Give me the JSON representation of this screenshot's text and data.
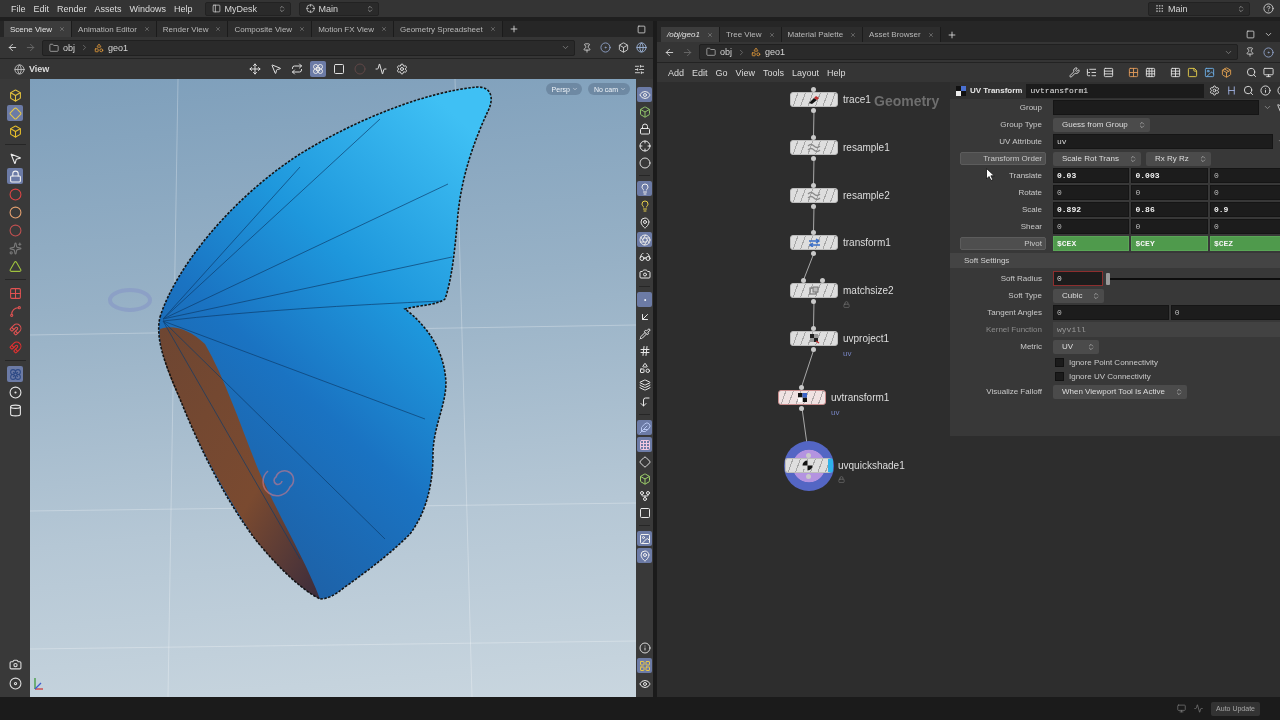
{
  "menu_bar": {
    "menus": [
      "File",
      "Edit",
      "Render",
      "Assets",
      "Windows",
      "Help"
    ],
    "desktop": "MyDesk",
    "context": "Main",
    "workspace": "Main"
  },
  "scene_pane": {
    "tabs": [
      {
        "label": "Scene View",
        "selected": true
      },
      {
        "label": "Animation Editor",
        "selected": false
      },
      {
        "label": "Render View",
        "selected": false
      },
      {
        "label": "Composite View",
        "selected": false
      },
      {
        "label": "Motion FX View",
        "selected": false
      },
      {
        "label": "Geometry Spreadsheet",
        "selected": false
      }
    ],
    "path": [
      "obj",
      "geo1"
    ],
    "view_toolbar": {
      "title": "View",
      "tools": [
        {
          "selected": false,
          "disabled": false
        },
        {
          "selected": false,
          "disabled": false
        },
        {
          "selected": false,
          "disabled": false
        },
        {
          "selected": true,
          "disabled": false
        },
        {
          "selected": false,
          "disabled": false
        },
        {
          "selected": false,
          "disabled": true
        },
        {
          "selected": false,
          "disabled": false
        },
        {
          "selected": false,
          "disabled": false
        }
      ]
    },
    "left_tools": {
      "top": [
        {
          "selected": false
        },
        {
          "selected": true
        },
        {
          "selected": false
        },
        {
          "selected": false
        },
        {
          "selected": true
        },
        {
          "selected": false
        },
        {
          "selected": false
        },
        {
          "selected": false
        },
        {
          "selected": false
        },
        {
          "selected": false
        },
        {
          "selected": false
        },
        {
          "selected": false
        },
        {
          "selected": false
        },
        {
          "selected": false
        },
        {
          "selected": true
        },
        {
          "selected": false
        },
        {
          "selected": false
        }
      ],
      "bottom": [
        {
          "selected": false
        },
        {
          "selected": false
        }
      ]
    },
    "right_tools": {
      "top": [
        {
          "selected": true
        },
        {
          "selected": false
        },
        {
          "selected": false
        },
        {
          "selected": false
        },
        {
          "selected": false
        },
        {
          "selected": true
        },
        {
          "selected": false
        },
        {
          "selected": false
        },
        {
          "selected": true
        },
        {
          "selected": false
        },
        {
          "selected": false
        },
        {
          "selected": true
        },
        {
          "selected": false
        },
        {
          "selected": false
        },
        {
          "selected": false
        },
        {
          "selected": false
        },
        {
          "selected": false
        },
        {
          "selected": false
        },
        {
          "selected": true
        },
        {
          "selected": true
        },
        {
          "selected": false
        },
        {
          "selected": false
        },
        {
          "selected": false
        },
        {
          "selected": false
        },
        {
          "selected": true
        },
        {
          "selected": true
        }
      ],
      "bottom": [
        {
          "selected": false
        },
        {
          "selected": true
        },
        {
          "selected": false
        }
      ]
    },
    "viewport": {
      "badges": [
        "Persp",
        "No cam"
      ]
    }
  },
  "network_pane": {
    "tabs": [
      {
        "label": "/obj/geo1",
        "selected": true
      },
      {
        "label": "Tree View",
        "selected": false
      },
      {
        "label": "Material Palette",
        "selected": false
      },
      {
        "label": "Asset Browser",
        "selected": false
      }
    ],
    "path": [
      "obj",
      "geo1"
    ],
    "menus": [
      "Add",
      "Edit",
      "Go",
      "View",
      "Tools",
      "Layout",
      "Help"
    ],
    "context_label": "Geometry",
    "nodes": [
      {
        "name": "trace1",
        "selected": false,
        "display": false,
        "locked": false
      },
      {
        "name": "resample1",
        "selected": false,
        "display": false,
        "locked": false
      },
      {
        "name": "resample2",
        "selected": false,
        "display": false,
        "locked": false
      },
      {
        "name": "transform1",
        "selected": false,
        "display": false,
        "locked": false
      },
      {
        "name": "matchsize2",
        "selected": false,
        "display": false,
        "locked": true
      },
      {
        "name": "uvproject1",
        "selected": false,
        "display": false,
        "locked": false,
        "tag": "uv"
      },
      {
        "name": "uvtransform1",
        "selected": true,
        "display": false,
        "locked": false,
        "tag": "uv"
      },
      {
        "name": "uvquickshade1",
        "selected": false,
        "display": true,
        "locked": true
      }
    ]
  },
  "parameters": {
    "type": "UV Transform",
    "name": "uvtransform1",
    "rows": [
      {
        "kind": "field",
        "label": "Group",
        "highlighted": false,
        "disabled": false,
        "picker": true
      },
      {
        "kind": "menus",
        "label": "Group Type",
        "highlighted": false,
        "menus": [
          "Guess from Group"
        ]
      },
      {
        "kind": "field",
        "label": "UV Attribute",
        "highlighted": false,
        "disabled": false,
        "picker": false,
        "value": "uv"
      },
      {
        "kind": "menus",
        "label": "Transform Order",
        "highlighted": true,
        "menus": [
          "Scale Rot Trans",
          "Rx Ry Rz"
        ]
      },
      {
        "kind": "vector",
        "label": "Translate",
        "highlighted": false,
        "values": [
          {
            "text": "0.03",
            "modified": true,
            "expression": false
          },
          {
            "text": "0.003",
            "modified": true,
            "expression": false
          },
          {
            "text": "0",
            "modified": false,
            "expression": false
          }
        ]
      },
      {
        "kind": "vector",
        "label": "Rotate",
        "highlighted": false,
        "values": [
          {
            "text": "0",
            "modified": false,
            "expression": false
          },
          {
            "text": "0",
            "modified": false,
            "expression": false
          },
          {
            "text": "0",
            "modified": false,
            "expression": false
          }
        ]
      },
      {
        "kind": "vector",
        "label": "Scale",
        "highlighted": false,
        "values": [
          {
            "text": "0.892",
            "modified": true,
            "expression": false
          },
          {
            "text": "0.86",
            "modified": true,
            "expression": false
          },
          {
            "text": "0.9",
            "modified": true,
            "expression": false
          }
        ]
      },
      {
        "kind": "vector",
        "label": "Shear",
        "highlighted": false,
        "values": [
          {
            "text": "0",
            "modified": false,
            "expression": false
          },
          {
            "text": "0",
            "modified": false,
            "expression": false
          },
          {
            "text": "0",
            "modified": false,
            "expression": false
          }
        ]
      },
      {
        "kind": "vector",
        "label": "Pivot",
        "highlighted": true,
        "values": [
          {
            "text": "$CEX",
            "modified": true,
            "expression": true
          },
          {
            "text": "$CEY",
            "modified": true,
            "expression": true
          },
          {
            "text": "$CEZ",
            "modified": true,
            "expression": true
          }
        ]
      },
      {
        "kind": "folder",
        "label": "Soft Settings"
      },
      {
        "kind": "slider",
        "label": "Soft Radius",
        "highlighted": false,
        "value": "0",
        "level": 0
      },
      {
        "kind": "menus",
        "label": "Soft Type",
        "highlighted": false,
        "menus": [
          "Cubic"
        ]
      },
      {
        "kind": "vector",
        "label": "Tangent Angles",
        "highlighted": false,
        "values": [
          {
            "text": "0",
            "modified": false,
            "expression": false
          },
          {
            "text": "0",
            "modified": false,
            "expression": false
          }
        ]
      },
      {
        "kind": "field",
        "label": "Kernel Function",
        "highlighted": false,
        "disabled": true,
        "picker": false,
        "value": "wyvill"
      },
      {
        "kind": "menus",
        "label": "Metric",
        "highlighted": false,
        "menus": [
          "UV"
        ]
      },
      {
        "kind": "toggle",
        "label": "Ignore Point Connectivity",
        "checked": false
      },
      {
        "kind": "toggle",
        "label": "Ignore UV Connectivity",
        "checked": false
      },
      {
        "kind": "menus",
        "label": "Visualize Falloff",
        "highlighted": false,
        "menus": [
          "When Viewport Tool Is Active"
        ]
      }
    ]
  },
  "status_bar": {
    "button": "Auto Update"
  }
}
